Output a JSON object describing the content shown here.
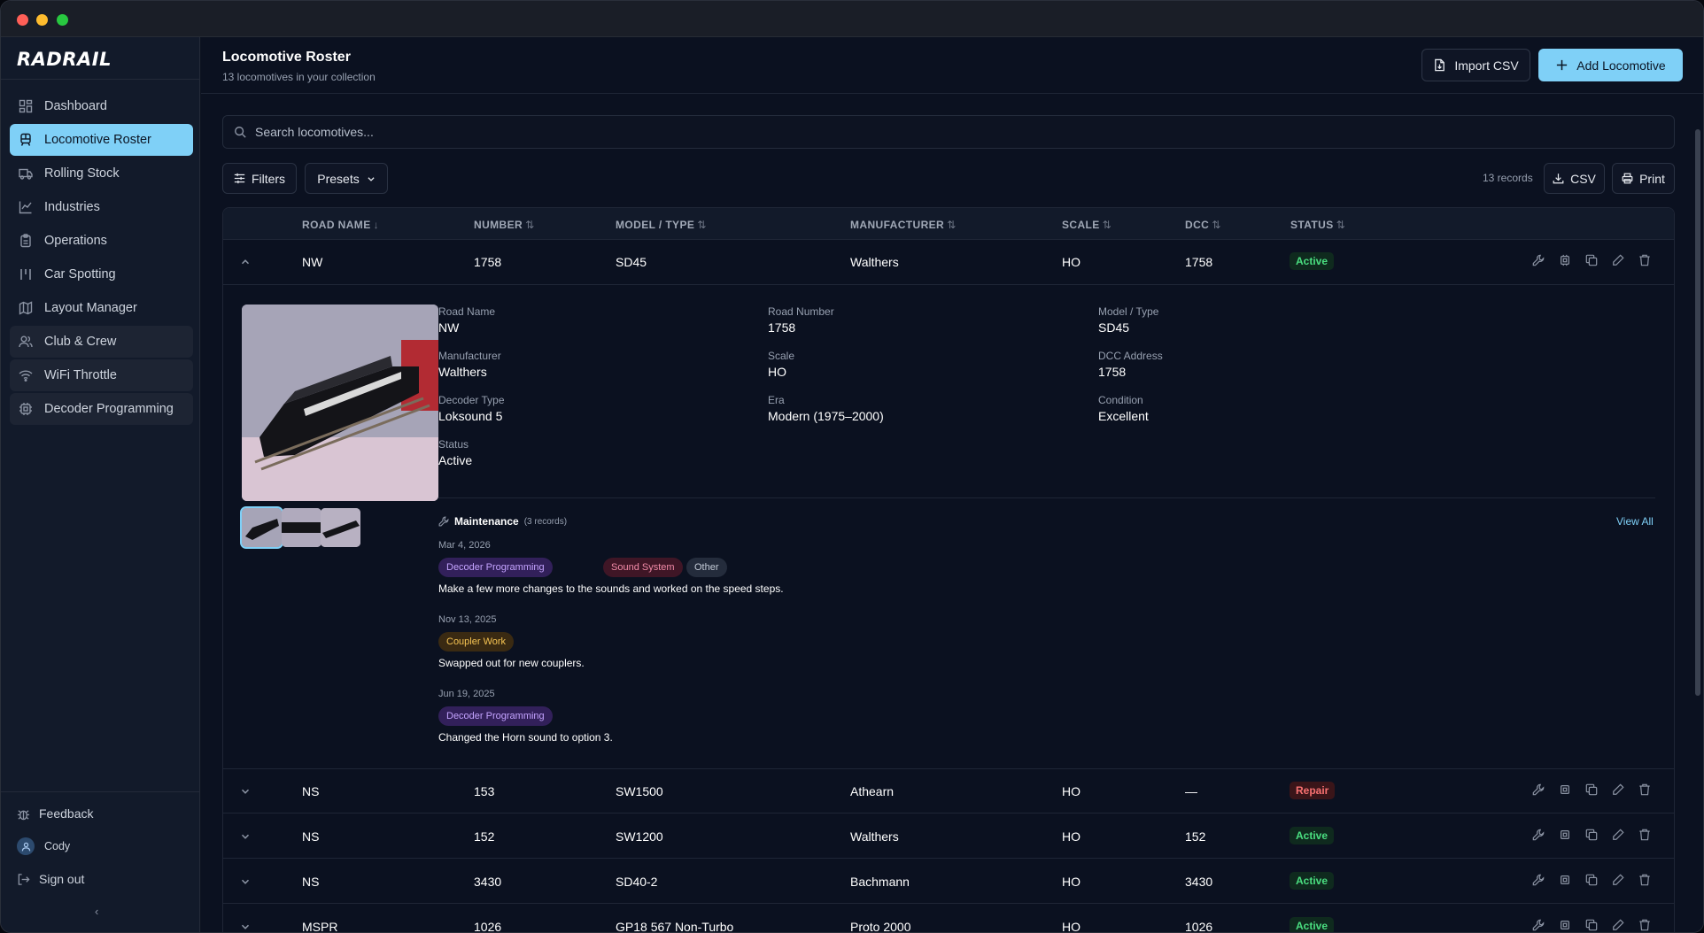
{
  "window": {
    "title": ""
  },
  "sidebar": {
    "logo": "RADRAIL",
    "items": [
      {
        "label": "Dashboard",
        "icon": "dashboard-icon"
      },
      {
        "label": "Locomotive Roster",
        "icon": "train-icon"
      },
      {
        "label": "Rolling Stock",
        "icon": "truck-icon"
      },
      {
        "label": "Industries",
        "icon": "chart-icon"
      },
      {
        "label": "Operations",
        "icon": "clipboard-icon"
      },
      {
        "label": "Car Spotting",
        "icon": "spotting-icon"
      },
      {
        "label": "Layout Manager",
        "icon": "map-icon"
      },
      {
        "label": "Club & Crew",
        "icon": "users-icon"
      },
      {
        "label": "WiFi Throttle",
        "icon": "wifi-icon"
      },
      {
        "label": "Decoder Programming",
        "icon": "chip-icon"
      }
    ],
    "feedback": "Feedback",
    "user": "Cody",
    "signout": "Sign out",
    "collapse": "‹"
  },
  "header": {
    "title": "Locomotive Roster",
    "subtitle": "13 locomotives in your collection",
    "import_label": "Import CSV",
    "add_label": "Add Locomotive"
  },
  "search": {
    "placeholder": "Search locomotives..."
  },
  "toolbar": {
    "filters": "Filters",
    "presets": "Presets",
    "records": "13 records",
    "csv": "CSV",
    "print": "Print"
  },
  "table": {
    "columns": [
      "ROAD NAME",
      "NUMBER",
      "MODEL / TYPE",
      "MANUFACTURER",
      "SCALE",
      "DCC",
      "STATUS"
    ],
    "sort_icons": [
      "↓",
      "⇅",
      "⇅",
      "⇅",
      "⇅",
      "⇅",
      "⇅"
    ],
    "rows": [
      {
        "road": "NW",
        "number": "1758",
        "model": "SD45",
        "manufacturer": "Walthers",
        "scale": "HO",
        "dcc": "1758",
        "status": "Active"
      },
      {
        "road": "NS",
        "number": "153",
        "model": "SW1500",
        "manufacturer": "Athearn",
        "scale": "HO",
        "dcc": "—",
        "status": "Repair"
      },
      {
        "road": "NS",
        "number": "152",
        "model": "SW1200",
        "manufacturer": "Walthers",
        "scale": "HO",
        "dcc": "152",
        "status": "Active"
      },
      {
        "road": "NS",
        "number": "3430",
        "model": "SD40-2",
        "manufacturer": "Bachmann",
        "scale": "HO",
        "dcc": "3430",
        "status": "Active"
      },
      {
        "road": "MSPR",
        "number": "1026",
        "model": "GP18 567 Non-Turbo",
        "manufacturer": "Proto 2000",
        "scale": "HO",
        "dcc": "1026",
        "status": "Active"
      }
    ]
  },
  "detail": {
    "fields": [
      {
        "label": "Road Name",
        "value": "NW"
      },
      {
        "label": "Road Number",
        "value": "1758"
      },
      {
        "label": "Model / Type",
        "value": "SD45"
      },
      {
        "label": "Manufacturer",
        "value": "Walthers"
      },
      {
        "label": "Scale",
        "value": "HO"
      },
      {
        "label": "DCC Address",
        "value": "1758"
      },
      {
        "label": "Decoder Type",
        "value": "Loksound 5"
      },
      {
        "label": "Era",
        "value": "Modern (1975–2000)"
      },
      {
        "label": "Condition",
        "value": "Excellent"
      },
      {
        "label": "Status",
        "value": "Active"
      }
    ],
    "maintenance_title": "Maintenance",
    "maintenance_count": "(3 records)",
    "view_all": "View All",
    "entries": [
      {
        "date": "Mar 4, 2026",
        "tags": [
          "Decoder Programming",
          "Sound System",
          "Other"
        ],
        "note": "Make a few more changes to the sounds and worked on the speed steps."
      },
      {
        "date": "Nov 13, 2025",
        "tags": [
          "Coupler Work"
        ],
        "note": "Swapped out for new couplers."
      },
      {
        "date": "Jun 19, 2025",
        "tags": [
          "Decoder Programming"
        ],
        "note": "Changed the Horn sound to option 3."
      }
    ]
  },
  "colors": {
    "accent": "#7fd0f7",
    "active": "#4ade80",
    "repair": "#f87171",
    "background": "#0b1120"
  }
}
